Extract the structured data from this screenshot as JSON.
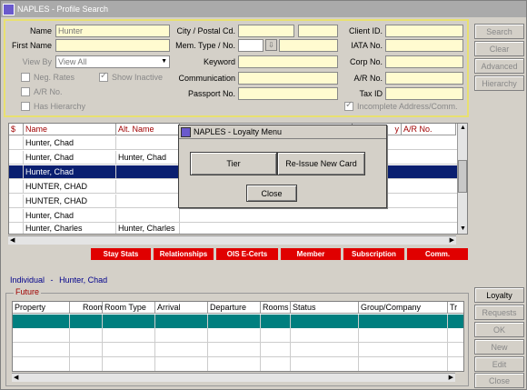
{
  "window": {
    "title": "NAPLES - Profile Search"
  },
  "search": {
    "name_label": "Name",
    "name_value": "Hunter",
    "first_name_label": "First Name",
    "view_by_label": "View By",
    "view_by_value": "View All",
    "city_label": "City / Postal Cd.",
    "mem_type_label": "Mem. Type / No.",
    "keyword_label": "Keyword",
    "communication_label": "Communication",
    "passport_label": "Passport No.",
    "client_id_label": "Client ID.",
    "iata_label": "IATA No.",
    "corp_label": "Corp No.",
    "ar_no_label": "A/R No.",
    "tax_id_label": "Tax ID",
    "neg_rates_label": "Neg. Rates",
    "show_inactive_label": "Show Inactive",
    "ar_no_chk_label": "A/R No.",
    "has_hierarchy_label": "Has Hierarchy",
    "incomplete_label": "Incomplete Address/Comm."
  },
  "side_buttons": {
    "search": "Search",
    "clear": "Clear",
    "advanced": "Advanced",
    "hierarchy": "Hierarchy",
    "loyalty": "Loyalty",
    "requests": "Requests",
    "ok": "OK",
    "new": "New",
    "edit": "Edit",
    "close": "Close"
  },
  "results": {
    "columns": {
      "dollar": "$",
      "name": "Name",
      "alt_name": "Alt. Name",
      "city": "y",
      "ar_no": "A/R No."
    },
    "rows": [
      {
        "name": "Hunter, Chad",
        "alt": ""
      },
      {
        "name": "Hunter, Chad",
        "alt": "Hunter, Chad"
      },
      {
        "name": "Hunter, Chad",
        "alt": ""
      },
      {
        "name": "HUNTER, CHAD",
        "alt": ""
      },
      {
        "name": "HUNTER, CHAD",
        "alt": ""
      },
      {
        "name": "Hunter, Chad",
        "alt": ""
      },
      {
        "name": "Hunter, Charles",
        "alt": "Hunter, Charles"
      }
    ]
  },
  "red_buttons": [
    "Stay Stats",
    "Relationships",
    "OIS E-Certs",
    "Member",
    "Subscription",
    "Comm."
  ],
  "info": {
    "type": "Individual",
    "separator": "-",
    "name": "Hunter, Chad"
  },
  "future": {
    "label": "Future",
    "columns": [
      "Property",
      "Room",
      "Room Type",
      "Arrival",
      "Departure",
      "Rooms",
      "Status",
      "Group/Company",
      "Tr"
    ]
  },
  "dialog": {
    "title": "NAPLES - Loyalty Menu",
    "tier": "Tier",
    "reissue": "Re-Issue New Card",
    "close": "Close"
  },
  "colors": {
    "selected_row": "#0a1f70",
    "red_button": "#e00000",
    "teal_row": "#007f7f",
    "panel_border": "#e8e070"
  }
}
